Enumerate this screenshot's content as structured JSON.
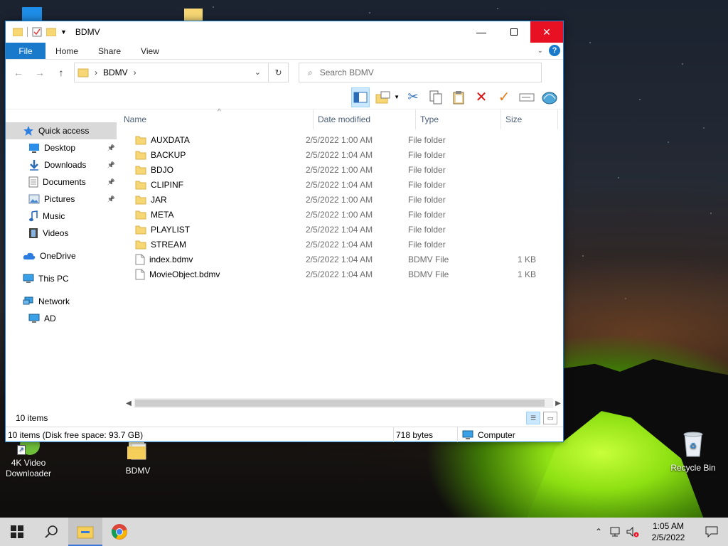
{
  "window": {
    "title": "BDMV",
    "tabs": [
      {
        "label": "File"
      },
      {
        "label": "Home"
      },
      {
        "label": "Share"
      },
      {
        "label": "View"
      }
    ],
    "address": {
      "path": "BDMV"
    },
    "search": {
      "placeholder": "Search BDMV"
    },
    "nav_pane": [
      {
        "label": "Quick access",
        "icon": "star-icon",
        "pinned": false,
        "selected": true,
        "indent": 0
      },
      {
        "label": "Desktop",
        "icon": "desktop-icon",
        "pinned": true,
        "indent": 1
      },
      {
        "label": "Downloads",
        "icon": "download-arrow-icon",
        "pinned": true,
        "indent": 1
      },
      {
        "label": "Documents",
        "icon": "documents-icon",
        "pinned": true,
        "indent": 1
      },
      {
        "label": "Pictures",
        "icon": "pictures-icon",
        "pinned": true,
        "indent": 1
      },
      {
        "label": "Music",
        "icon": "music-note-icon",
        "pinned": false,
        "indent": 1
      },
      {
        "label": "Videos",
        "icon": "film-icon",
        "pinned": false,
        "indent": 1
      },
      {
        "label": "OneDrive",
        "icon": "cloud-icon",
        "pinned": false,
        "indent": 0
      },
      {
        "label": "This PC",
        "icon": "computer-icon",
        "pinned": false,
        "indent": 0
      },
      {
        "label": "Network",
        "icon": "network-icon",
        "pinned": false,
        "indent": 0
      },
      {
        "label": "AD",
        "icon": "computer-icon",
        "pinned": false,
        "indent": 1
      }
    ],
    "columns": {
      "name": "Name",
      "date": "Date modified",
      "type": "Type",
      "size": "Size"
    },
    "files": [
      {
        "name": "AUXDATA",
        "date": "2/5/2022 1:00 AM",
        "type": "File folder",
        "size": "",
        "kind": "folder"
      },
      {
        "name": "BACKUP",
        "date": "2/5/2022 1:04 AM",
        "type": "File folder",
        "size": "",
        "kind": "folder"
      },
      {
        "name": "BDJO",
        "date": "2/5/2022 1:00 AM",
        "type": "File folder",
        "size": "",
        "kind": "folder"
      },
      {
        "name": "CLIPINF",
        "date": "2/5/2022 1:04 AM",
        "type": "File folder",
        "size": "",
        "kind": "folder"
      },
      {
        "name": "JAR",
        "date": "2/5/2022 1:00 AM",
        "type": "File folder",
        "size": "",
        "kind": "folder"
      },
      {
        "name": "META",
        "date": "2/5/2022 1:00 AM",
        "type": "File folder",
        "size": "",
        "kind": "folder"
      },
      {
        "name": "PLAYLIST",
        "date": "2/5/2022 1:04 AM",
        "type": "File folder",
        "size": "",
        "kind": "folder"
      },
      {
        "name": "STREAM",
        "date": "2/5/2022 1:04 AM",
        "type": "File folder",
        "size": "",
        "kind": "folder"
      },
      {
        "name": "index.bdmv",
        "date": "2/5/2022 1:04 AM",
        "type": "BDMV File",
        "size": "1 KB",
        "kind": "file"
      },
      {
        "name": "MovieObject.bdmv",
        "date": "2/5/2022 1:04 AM",
        "type": "BDMV File",
        "size": "1 KB",
        "kind": "file"
      }
    ],
    "item_count": "10 items",
    "status": {
      "disk": "10 items (Disk free space: 93.7 GB)",
      "bytes": "718 bytes",
      "location": "Computer"
    }
  },
  "desktop": {
    "icons": [
      {
        "label": "4K Video Downloader"
      },
      {
        "label": "BDMV"
      },
      {
        "label": "Recycle Bin"
      }
    ]
  },
  "taskbar": {
    "time": "1:05 AM",
    "date": "2/5/2022"
  },
  "colors": {
    "accent": "#1979ca",
    "close_red": "#e81123",
    "folder_yellow": "#f7d674"
  }
}
